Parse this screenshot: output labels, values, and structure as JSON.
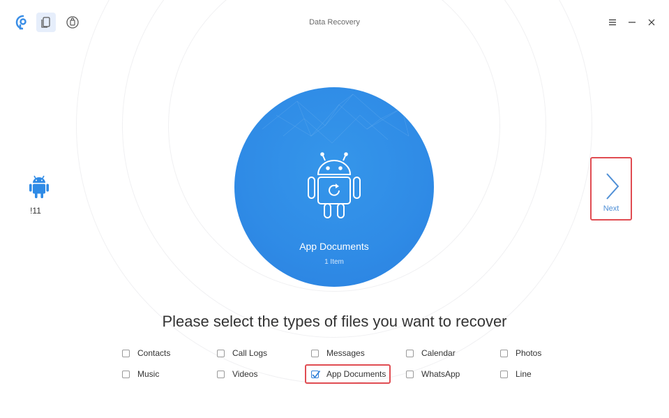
{
  "window": {
    "title": "Data Recovery",
    "icons": [
      "phonerescue-logo-icon",
      "data-recovery-icon",
      "ios-mode-icon"
    ],
    "controls": [
      "menu-icon",
      "minimize-icon",
      "close-icon"
    ]
  },
  "device": {
    "name": "!11",
    "icon": "android-icon"
  },
  "hero": {
    "category": "App Documents",
    "count": "1 Item",
    "icon": "android-restore-icon"
  },
  "next": {
    "label": "Next",
    "icon": "chevron-right-icon"
  },
  "instruction": "Please select the types of files you want to recover",
  "options": [
    {
      "label": "Contacts",
      "checked": false
    },
    {
      "label": "Call Logs",
      "checked": false
    },
    {
      "label": "Messages",
      "checked": false
    },
    {
      "label": "Calendar",
      "checked": false
    },
    {
      "label": "Photos",
      "checked": false
    },
    {
      "label": "Music",
      "checked": false
    },
    {
      "label": "Videos",
      "checked": false
    },
    {
      "label": "App Documents",
      "checked": true
    },
    {
      "label": "WhatsApp",
      "checked": false
    },
    {
      "label": "Line",
      "checked": false
    }
  ],
  "colors": {
    "accent": "#2f8be6",
    "highlight": "#e04c52",
    "next_arrow": "#4f8fd6",
    "android_device": "#2f8be6"
  }
}
